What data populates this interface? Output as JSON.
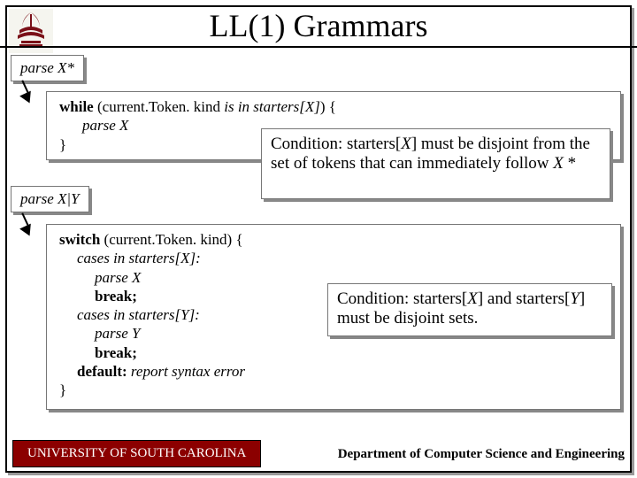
{
  "title": "LL(1) Grammars",
  "label1": "parse X*",
  "label2": "parse X|Y",
  "code1": {
    "l1a": "while",
    "l1b": " (current.Token. kind ",
    "l1c": "is in starters[X]",
    "l1d": ") {",
    "l2": "parse X",
    "l3": "}"
  },
  "note1": {
    "t1": "Condition: starters[",
    "t2": "X",
    "t3": "] must be disjoint from the set of tokens that can immediately follow ",
    "t4": "X ",
    "t5": "*"
  },
  "code2": {
    "l1a": "switch",
    "l1b": " (current.Token. kind) {",
    "l2a": "cases in starters[X]:",
    "l3": "parse X",
    "l4": "break;",
    "l5a": "cases in starters[Y]:",
    "l6": "parse Y",
    "l7": "break;",
    "l8a": "default:",
    "l8b": " report syntax error",
    "l9": "}"
  },
  "note2": {
    "t1": "Condition: starters[",
    "t2": "X",
    "t3": "] and starters[",
    "t4": "Y",
    "t5": "] must be disjoint sets."
  },
  "footer": {
    "uni": "UNIVERSITY OF SOUTH CAROLINA",
    "dept": "Department of Computer Science and Engineering"
  }
}
